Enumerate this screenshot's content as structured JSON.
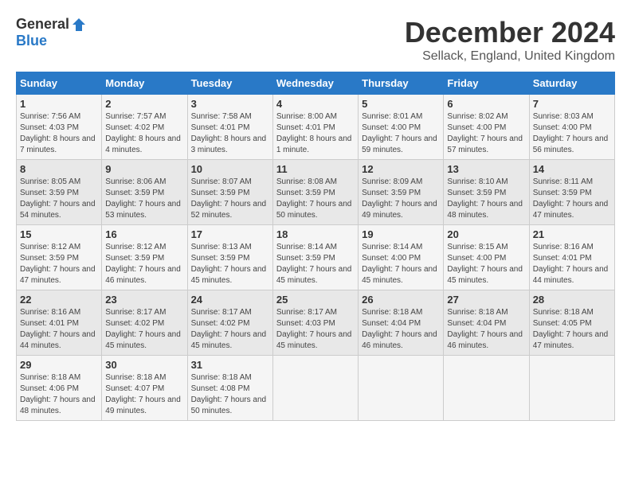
{
  "header": {
    "logo_general": "General",
    "logo_blue": "Blue",
    "title": "December 2024",
    "subtitle": "Sellack, England, United Kingdom"
  },
  "weekdays": [
    "Sunday",
    "Monday",
    "Tuesday",
    "Wednesday",
    "Thursday",
    "Friday",
    "Saturday"
  ],
  "weeks": [
    [
      {
        "day": "1",
        "sunrise": "7:56 AM",
        "sunset": "4:03 PM",
        "daylight": "8 hours and 7 minutes."
      },
      {
        "day": "2",
        "sunrise": "7:57 AM",
        "sunset": "4:02 PM",
        "daylight": "8 hours and 4 minutes."
      },
      {
        "day": "3",
        "sunrise": "7:58 AM",
        "sunset": "4:01 PM",
        "daylight": "8 hours and 3 minutes."
      },
      {
        "day": "4",
        "sunrise": "8:00 AM",
        "sunset": "4:01 PM",
        "daylight": "8 hours and 1 minute."
      },
      {
        "day": "5",
        "sunrise": "8:01 AM",
        "sunset": "4:00 PM",
        "daylight": "7 hours and 59 minutes."
      },
      {
        "day": "6",
        "sunrise": "8:02 AM",
        "sunset": "4:00 PM",
        "daylight": "7 hours and 57 minutes."
      },
      {
        "day": "7",
        "sunrise": "8:03 AM",
        "sunset": "4:00 PM",
        "daylight": "7 hours and 56 minutes."
      }
    ],
    [
      {
        "day": "8",
        "sunrise": "8:05 AM",
        "sunset": "3:59 PM",
        "daylight": "7 hours and 54 minutes."
      },
      {
        "day": "9",
        "sunrise": "8:06 AM",
        "sunset": "3:59 PM",
        "daylight": "7 hours and 53 minutes."
      },
      {
        "day": "10",
        "sunrise": "8:07 AM",
        "sunset": "3:59 PM",
        "daylight": "7 hours and 52 minutes."
      },
      {
        "day": "11",
        "sunrise": "8:08 AM",
        "sunset": "3:59 PM",
        "daylight": "7 hours and 50 minutes."
      },
      {
        "day": "12",
        "sunrise": "8:09 AM",
        "sunset": "3:59 PM",
        "daylight": "7 hours and 49 minutes."
      },
      {
        "day": "13",
        "sunrise": "8:10 AM",
        "sunset": "3:59 PM",
        "daylight": "7 hours and 48 minutes."
      },
      {
        "day": "14",
        "sunrise": "8:11 AM",
        "sunset": "3:59 PM",
        "daylight": "7 hours and 47 minutes."
      }
    ],
    [
      {
        "day": "15",
        "sunrise": "8:12 AM",
        "sunset": "3:59 PM",
        "daylight": "7 hours and 47 minutes."
      },
      {
        "day": "16",
        "sunrise": "8:12 AM",
        "sunset": "3:59 PM",
        "daylight": "7 hours and 46 minutes."
      },
      {
        "day": "17",
        "sunrise": "8:13 AM",
        "sunset": "3:59 PM",
        "daylight": "7 hours and 45 minutes."
      },
      {
        "day": "18",
        "sunrise": "8:14 AM",
        "sunset": "3:59 PM",
        "daylight": "7 hours and 45 minutes."
      },
      {
        "day": "19",
        "sunrise": "8:14 AM",
        "sunset": "4:00 PM",
        "daylight": "7 hours and 45 minutes."
      },
      {
        "day": "20",
        "sunrise": "8:15 AM",
        "sunset": "4:00 PM",
        "daylight": "7 hours and 45 minutes."
      },
      {
        "day": "21",
        "sunrise": "8:16 AM",
        "sunset": "4:01 PM",
        "daylight": "7 hours and 44 minutes."
      }
    ],
    [
      {
        "day": "22",
        "sunrise": "8:16 AM",
        "sunset": "4:01 PM",
        "daylight": "7 hours and 44 minutes."
      },
      {
        "day": "23",
        "sunrise": "8:17 AM",
        "sunset": "4:02 PM",
        "daylight": "7 hours and 45 minutes."
      },
      {
        "day": "24",
        "sunrise": "8:17 AM",
        "sunset": "4:02 PM",
        "daylight": "7 hours and 45 minutes."
      },
      {
        "day": "25",
        "sunrise": "8:17 AM",
        "sunset": "4:03 PM",
        "daylight": "7 hours and 45 minutes."
      },
      {
        "day": "26",
        "sunrise": "8:18 AM",
        "sunset": "4:04 PM",
        "daylight": "7 hours and 46 minutes."
      },
      {
        "day": "27",
        "sunrise": "8:18 AM",
        "sunset": "4:04 PM",
        "daylight": "7 hours and 46 minutes."
      },
      {
        "day": "28",
        "sunrise": "8:18 AM",
        "sunset": "4:05 PM",
        "daylight": "7 hours and 47 minutes."
      }
    ],
    [
      {
        "day": "29",
        "sunrise": "8:18 AM",
        "sunset": "4:06 PM",
        "daylight": "7 hours and 48 minutes."
      },
      {
        "day": "30",
        "sunrise": "8:18 AM",
        "sunset": "4:07 PM",
        "daylight": "7 hours and 49 minutes."
      },
      {
        "day": "31",
        "sunrise": "8:18 AM",
        "sunset": "4:08 PM",
        "daylight": "7 hours and 50 minutes."
      },
      null,
      null,
      null,
      null
    ]
  ],
  "labels": {
    "sunrise": "Sunrise:",
    "sunset": "Sunset:",
    "daylight": "Daylight:"
  }
}
